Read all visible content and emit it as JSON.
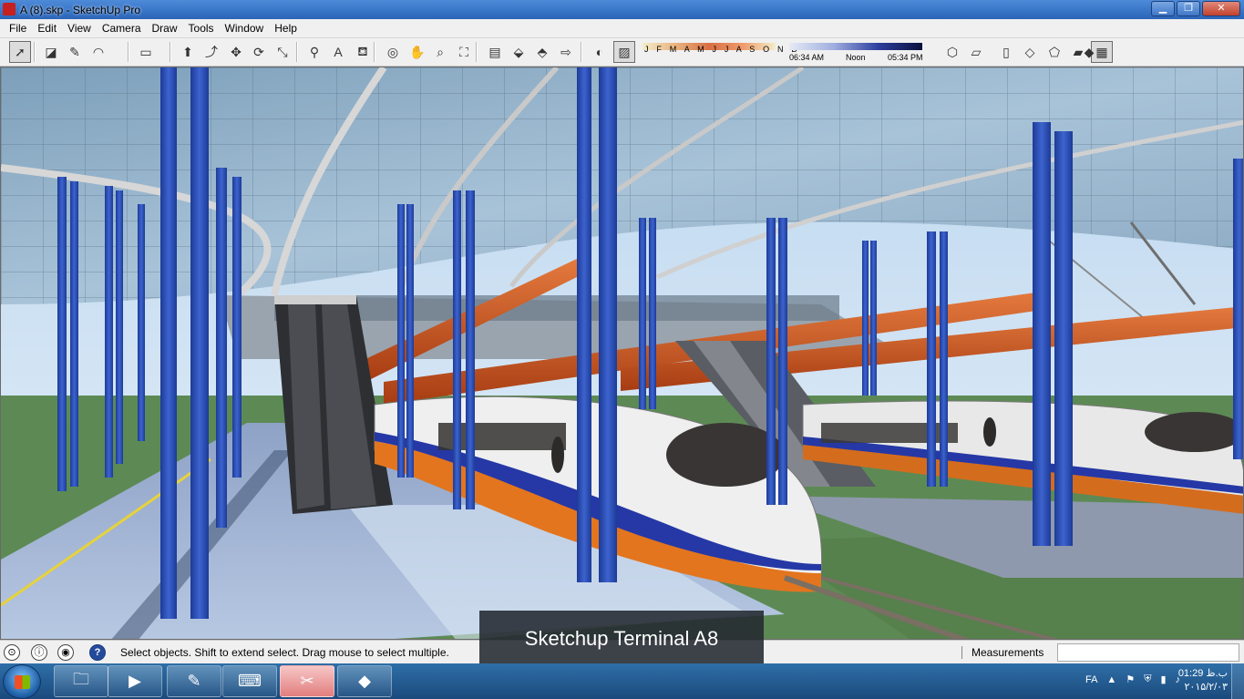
{
  "window": {
    "title": "A (8).skp - SketchUp Pro",
    "minimize": "▁",
    "maximize": "❐",
    "close": "✕"
  },
  "menu": [
    "File",
    "Edit",
    "View",
    "Camera",
    "Draw",
    "Tools",
    "Window",
    "Help"
  ],
  "toolbar": {
    "tools": [
      {
        "name": "select-tool-button",
        "glyph": "➚"
      },
      {
        "name": "eraser-tool-button",
        "glyph": "◪"
      },
      {
        "name": "pencil-tool-button",
        "glyph": "✎"
      },
      {
        "name": "arc-tool-button",
        "glyph": "◠"
      },
      {
        "name": "shape-tool-button",
        "glyph": "▭"
      },
      {
        "name": "push-pull-tool-button",
        "glyph": "⬆"
      },
      {
        "name": "follow-me-tool-button",
        "glyph": "⤴"
      },
      {
        "name": "move-tool-button",
        "glyph": "✥"
      },
      {
        "name": "rotate-tool-button",
        "glyph": "⟳"
      },
      {
        "name": "scale-tool-button",
        "glyph": "⤡"
      },
      {
        "name": "tape-measure-tool-button",
        "glyph": "⚲"
      },
      {
        "name": "text-tool-button",
        "glyph": "A"
      },
      {
        "name": "paint-bucket-tool-button",
        "glyph": "⛾"
      },
      {
        "name": "orbit-tool-button",
        "glyph": "◎"
      },
      {
        "name": "pan-tool-button",
        "glyph": "✋"
      },
      {
        "name": "zoom-tool-button",
        "glyph": "⌕"
      },
      {
        "name": "zoom-extents-button",
        "glyph": "⛶"
      },
      {
        "name": "warehouse-button",
        "glyph": "▤"
      },
      {
        "name": "share-model-button",
        "glyph": "⬙"
      },
      {
        "name": "share-component-button",
        "glyph": "⬘"
      },
      {
        "name": "extension-button",
        "glyph": "⇨"
      },
      {
        "name": "shadows-button",
        "glyph": "◐"
      },
      {
        "name": "fog-button",
        "glyph": "▨"
      },
      {
        "name": "iso-view-button",
        "glyph": "⬡"
      },
      {
        "name": "top-view-button",
        "glyph": "▱"
      },
      {
        "name": "front-view-button",
        "glyph": "▯"
      },
      {
        "name": "right-view-button",
        "glyph": "◇"
      },
      {
        "name": "back-view-button",
        "glyph": "⬠"
      },
      {
        "name": "left-view-button",
        "glyph": "▰"
      },
      {
        "name": "xray-style-button",
        "glyph": "▦"
      },
      {
        "name": "style-shaded-button",
        "glyph": "◆"
      }
    ],
    "months": "J F M A M J J A S O N D",
    "time_start": "06:34 AM",
    "time_mid": "Noon",
    "time_end": "05:34 PM"
  },
  "status": {
    "hint": "Select objects. Shift to extend select. Drag mouse to select multiple.",
    "measurements_label": "Measurements",
    "measurements_value": ""
  },
  "caption": "Sketchup Terminal A8",
  "taskbar": {
    "apps": [
      {
        "name": "explorer-taskbar-button",
        "glyph": "🗀"
      },
      {
        "name": "media-player-taskbar-button",
        "glyph": "▶"
      },
      {
        "name": "notepad-taskbar-button",
        "glyph": "✎"
      },
      {
        "name": "keyboard-taskbar-button",
        "glyph": "⌨"
      },
      {
        "name": "snipping-tool-taskbar-button",
        "glyph": "✂"
      },
      {
        "name": "sketchup-taskbar-button",
        "glyph": "◆"
      }
    ],
    "language": "FA",
    "time": "01:29 ب.ظ",
    "date": "۲۰۱۵/۲/۰۳"
  },
  "colors": {
    "title_bar": "#2a64b8",
    "taskbar": "#1a4a7c",
    "column_blue": "#2b4fb5",
    "beam_orange": "#d2561f"
  }
}
